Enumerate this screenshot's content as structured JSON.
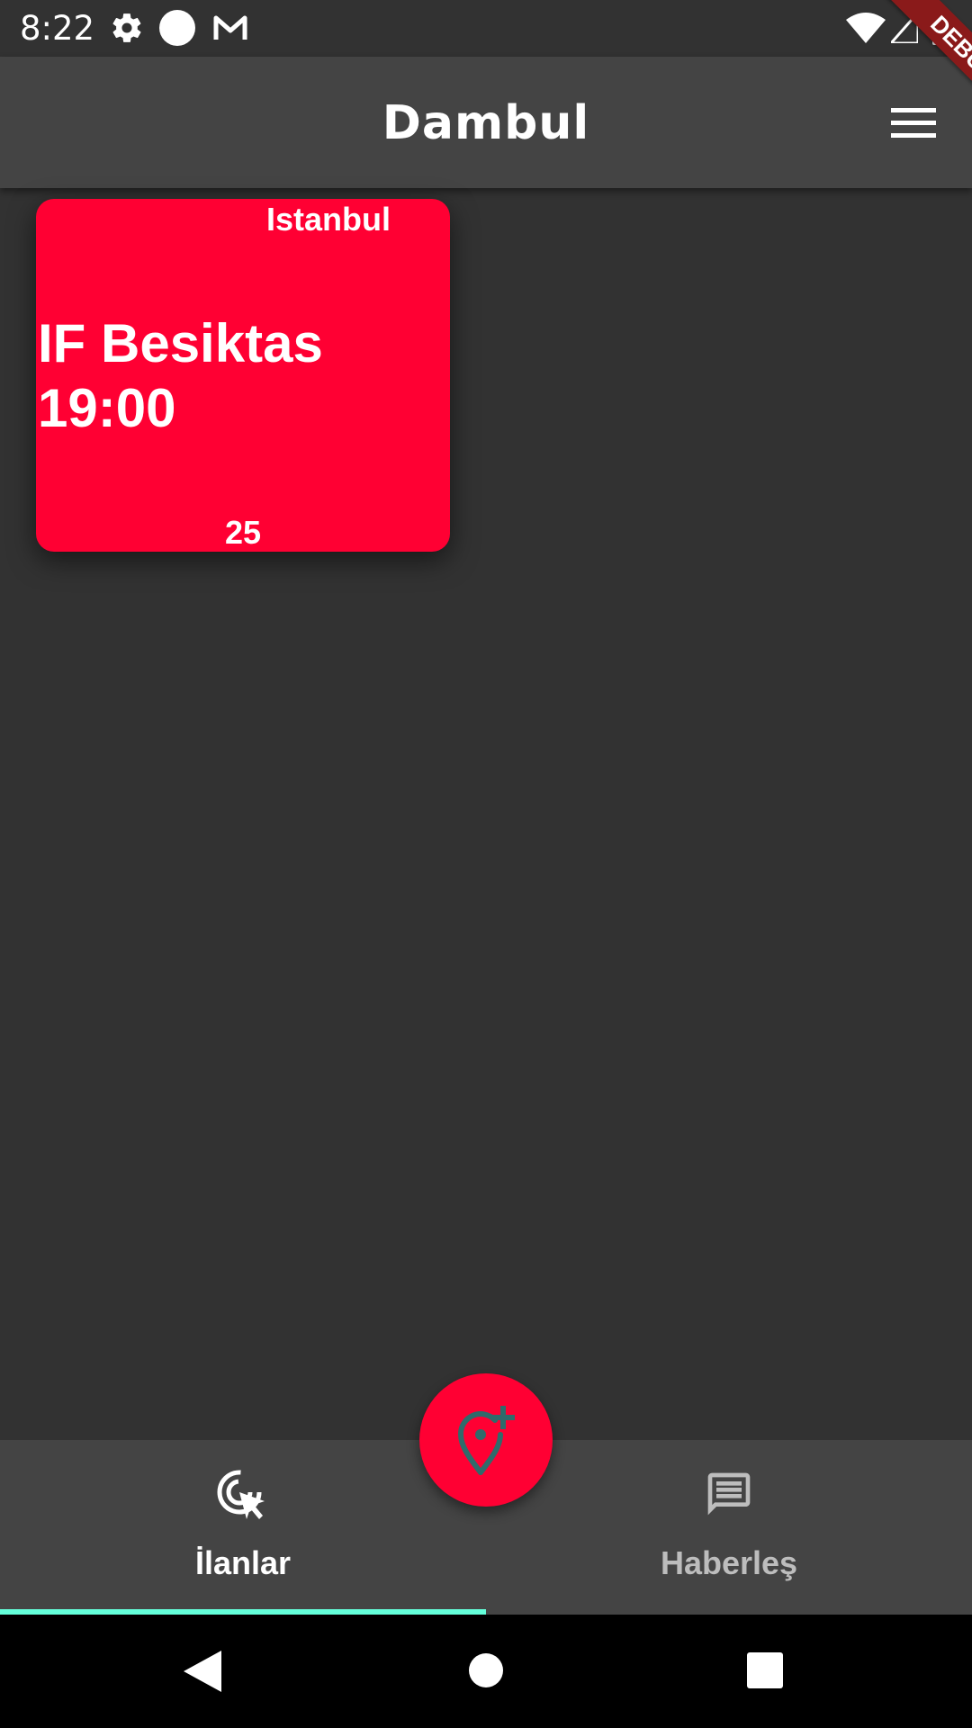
{
  "status_bar": {
    "time": "8:22",
    "icons": [
      "settings-icon",
      "circle-icon",
      "gmail-icon",
      "wifi-icon",
      "signal-icon",
      "battery-icon"
    ]
  },
  "app_bar": {
    "title": "Dambul",
    "menu_icon": "hamburger-menu-icon",
    "debug_label": "DEBUG"
  },
  "listings": [
    {
      "city": "Istanbul",
      "title": "IF Besiktas 19:00",
      "count": "25",
      "color": "#ff0033"
    }
  ],
  "fab": {
    "icon": "add-location-icon",
    "color": "#ff0033"
  },
  "bottom_nav": {
    "items": [
      {
        "label": "İlanlar",
        "icon": "ads-click-icon",
        "active": true
      },
      {
        "label": "Haberleş",
        "icon": "message-icon",
        "active": false
      }
    ],
    "indicator_color": "#64ffda"
  },
  "system_nav": {
    "buttons": [
      "back-icon",
      "home-icon",
      "recents-icon"
    ]
  },
  "colors": {
    "background": "#323232",
    "app_bar": "#444444",
    "accent": "#ff0033"
  }
}
